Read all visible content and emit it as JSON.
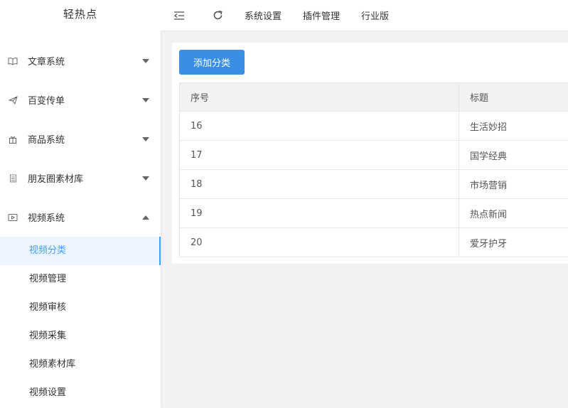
{
  "app": {
    "logo": "轻热点"
  },
  "header": {
    "nav": [
      "系统设置",
      "插件管理",
      "行业版"
    ]
  },
  "sidebar": {
    "items": [
      {
        "label": "文章系统",
        "icon": "book-icon",
        "expanded": false
      },
      {
        "label": "百变传单",
        "icon": "paper-plane-icon",
        "expanded": false
      },
      {
        "label": "商品系统",
        "icon": "gift-icon",
        "expanded": false
      },
      {
        "label": "朋友圈素材库",
        "icon": "document-icon",
        "expanded": false
      },
      {
        "label": "视频系统",
        "icon": "video-icon",
        "expanded": true
      }
    ],
    "video_submenu": [
      {
        "label": "视频分类",
        "active": true
      },
      {
        "label": "视频管理",
        "active": false
      },
      {
        "label": "视频审核",
        "active": false
      },
      {
        "label": "视频采集",
        "active": false
      },
      {
        "label": "视频素材库",
        "active": false
      },
      {
        "label": "视频设置",
        "active": false
      }
    ]
  },
  "main": {
    "add_button": "添加分类",
    "table": {
      "headers": [
        "序号",
        "标题"
      ],
      "rows": [
        [
          "16",
          "生活妙招"
        ],
        [
          "17",
          "国学经典"
        ],
        [
          "18",
          "市场营销"
        ],
        [
          "19",
          "热点新闻"
        ],
        [
          "20",
          "爱牙护牙"
        ]
      ]
    }
  },
  "colors": {
    "accent": "#409eff",
    "button": "#3a8ee6"
  }
}
